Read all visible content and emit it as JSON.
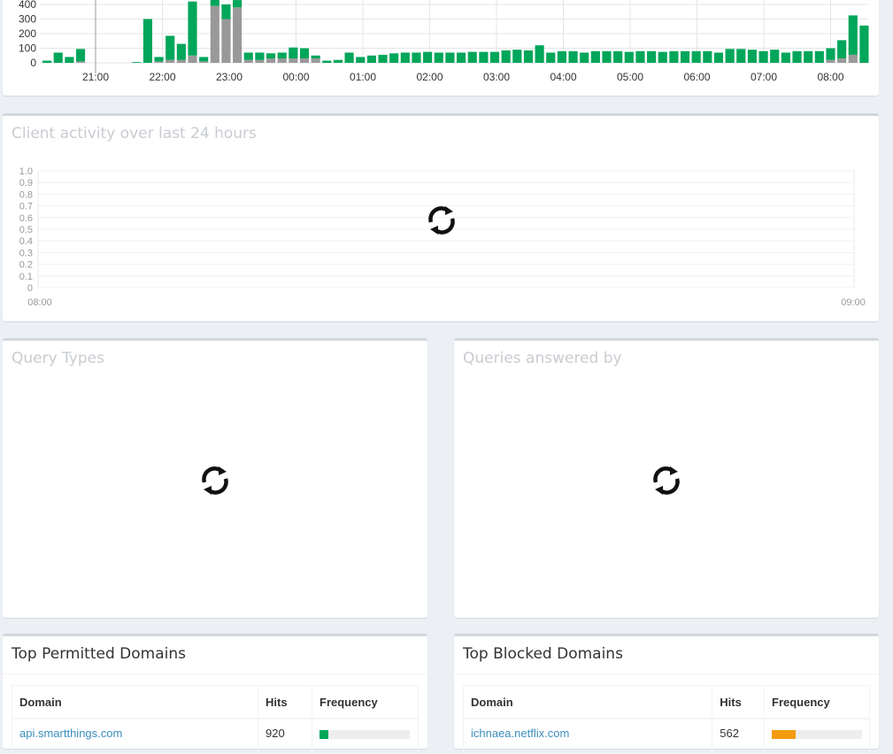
{
  "queries_chart": {
    "y_ticks": [
      "400",
      "300",
      "200",
      "100",
      "0"
    ],
    "x_ticks": [
      "21:00",
      "22:00",
      "23:00",
      "00:00",
      "01:00",
      "02:00",
      "03:00",
      "04:00",
      "05:00",
      "06:00",
      "07:00",
      "08:00"
    ],
    "colors": {
      "permitted": "#00a65a",
      "blocked": "#999999"
    }
  },
  "client_activity": {
    "title": "Client activity over last 24 hours",
    "y_ticks": [
      "1.0",
      "0.9",
      "0.8",
      "0.7",
      "0.6",
      "0.5",
      "0.4",
      "0.3",
      "0.2",
      "0.1",
      "0"
    ],
    "x_ticks": [
      "08:00",
      "09:00"
    ]
  },
  "query_types": {
    "title": "Query Types"
  },
  "queries_answered": {
    "title": "Queries answered by"
  },
  "top_permitted": {
    "title": "Top Permitted Domains",
    "headers": {
      "domain": "Domain",
      "hits": "Hits",
      "frequency": "Frequency"
    },
    "rows": [
      {
        "domain": "api.smartthings.com",
        "hits": "920",
        "frequency_pct": 10
      }
    ],
    "bar_color": "#00a65a"
  },
  "top_blocked": {
    "title": "Top Blocked Domains",
    "headers": {
      "domain": "Domain",
      "hits": "Hits",
      "frequency": "Frequency"
    },
    "rows": [
      {
        "domain": "ichnaea.netflix.com",
        "hits": "562",
        "frequency_pct": 26
      }
    ],
    "bar_color": "#f39c12"
  },
  "chart_data": {
    "type": "bar",
    "stacked": true,
    "ylim": [
      0,
      400
    ],
    "x_ticks": [
      "21:00",
      "22:00",
      "23:00",
      "00:00",
      "01:00",
      "02:00",
      "03:00",
      "04:00",
      "05:00",
      "06:00",
      "07:00",
      "08:00"
    ],
    "series": [
      {
        "values": [
          15,
          70,
          40,
          85,
          0,
          0,
          0,
          0,
          5,
          300,
          30,
          165,
          110,
          370,
          30,
          420,
          100,
          50,
          50,
          50,
          35,
          40,
          75,
          70,
          20,
          15,
          20,
          70,
          40,
          50,
          55,
          65,
          70,
          70,
          75,
          70,
          70,
          70,
          75,
          75,
          75,
          85,
          90,
          85,
          120,
          70,
          80,
          80,
          70,
          80,
          80,
          80,
          75,
          80,
          80,
          75,
          80,
          80,
          80,
          80,
          70,
          95,
          95,
          90,
          80,
          90,
          70,
          80,
          80,
          80,
          80,
          125,
          270,
          255
        ]
      },
      {
        "values": [
          0,
          0,
          0,
          10,
          0,
          0,
          0,
          0,
          0,
          0,
          10,
          20,
          20,
          50,
          10,
          390,
          300,
          380,
          20,
          20,
          30,
          30,
          30,
          30,
          30,
          0,
          0,
          0,
          0,
          0,
          0,
          0,
          0,
          0,
          0,
          0,
          0,
          0,
          0,
          0,
          0,
          0,
          0,
          0,
          0,
          0,
          0,
          0,
          0,
          0,
          0,
          0,
          0,
          0,
          0,
          0,
          0,
          0,
          0,
          0,
          0,
          0,
          0,
          0,
          0,
          0,
          0,
          0,
          0,
          0,
          20,
          30,
          55,
          0
        ]
      }
    ]
  }
}
